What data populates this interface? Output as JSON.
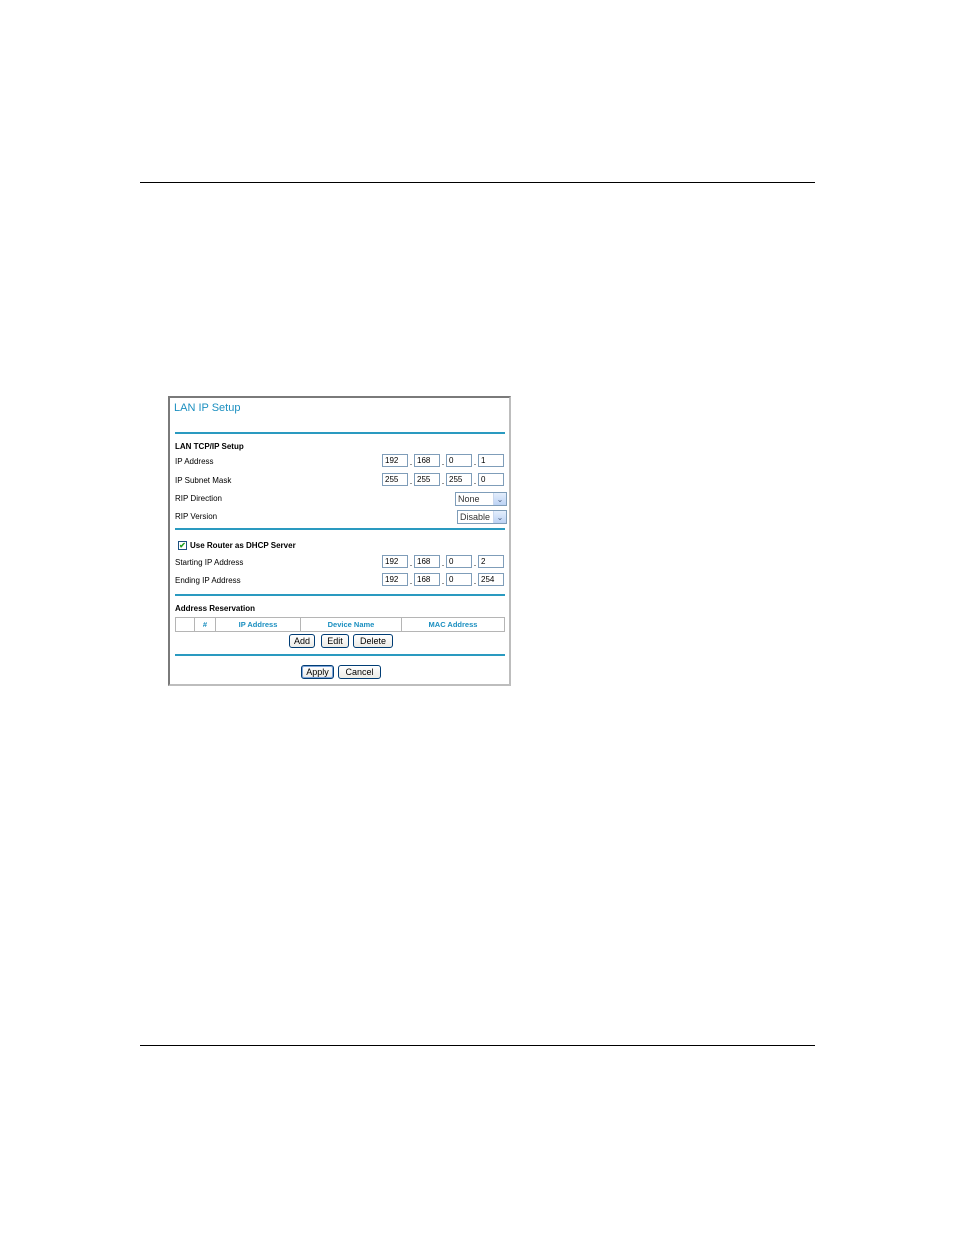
{
  "panel": {
    "title": "LAN IP Setup",
    "tcpip_section": {
      "heading": "LAN TCP/IP Setup",
      "ip_address": {
        "label": "IP Address",
        "octets": [
          "192",
          "168",
          "0",
          "1"
        ]
      },
      "subnet_mask": {
        "label": "IP Subnet Mask",
        "octets": [
          "255",
          "255",
          "255",
          "0"
        ]
      },
      "rip_direction": {
        "label": "RIP Direction",
        "selected": "None"
      },
      "rip_version": {
        "label": "RIP Version",
        "selected": "Disable"
      }
    },
    "dhcp_section": {
      "checkbox_label": "Use Router as DHCP Server",
      "checked": true,
      "check_glyph": "✔",
      "starting_ip": {
        "label": "Starting IP Address",
        "octets": [
          "192",
          "168",
          "0",
          "2"
        ]
      },
      "ending_ip": {
        "label": "Ending IP Address",
        "octets": [
          "192",
          "168",
          "0",
          "254"
        ]
      }
    },
    "reservation_section": {
      "heading": "Address Reservation",
      "columns": [
        "",
        "#",
        "IP Address",
        "Device Name",
        "MAC Address"
      ],
      "buttons": {
        "add": "Add",
        "edit": "Edit",
        "delete": "Delete"
      }
    },
    "footer_buttons": {
      "apply": "Apply",
      "cancel": "Cancel"
    },
    "select_arrow_glyph": "⌄"
  },
  "colors": {
    "accent": "#1b8fc0",
    "separator": "#2a9ac0"
  }
}
